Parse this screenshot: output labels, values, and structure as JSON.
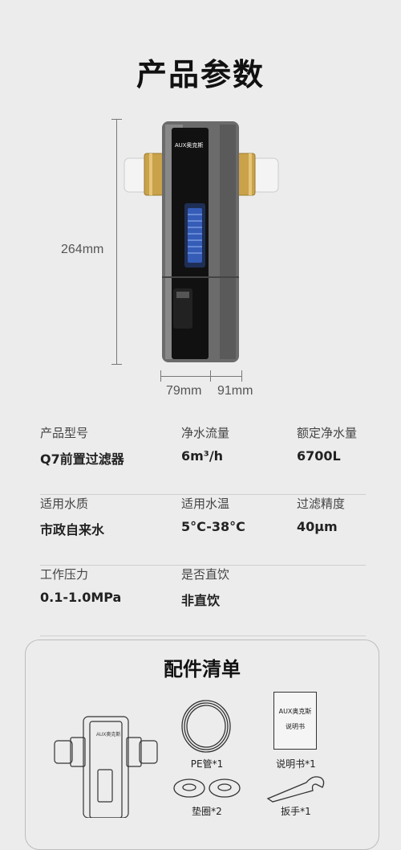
{
  "page_title": "产品参数",
  "dimensions": {
    "height": "264mm",
    "width": "79mm",
    "depth": "91mm"
  },
  "device_brand": "AUX奥克斯",
  "specs": [
    [
      {
        "label": "产品型号",
        "value": "Q7前置过滤器"
      },
      {
        "label": "净水流量",
        "value": "6m³/h"
      },
      {
        "label": "额定净水量",
        "value": "6700L"
      }
    ],
    [
      {
        "label": "适用水质",
        "value": "市政自来水"
      },
      {
        "label": "适用水温",
        "value": "5°C-38°C"
      },
      {
        "label": "过滤精度",
        "value": "40μm"
      }
    ],
    [
      {
        "label": "工作压力",
        "value": "0.1-1.0MPa"
      },
      {
        "label": "是否直饮",
        "value": "非直饮"
      }
    ]
  ],
  "accessories": {
    "title": "配件清单",
    "items": [
      {
        "label": "PE管*1"
      },
      {
        "label": "说明书*1"
      },
      {
        "label": "垫圈*2"
      },
      {
        "label": "扳手*1"
      }
    ],
    "manual_brand": "AUX奥克斯",
    "manual_text": "说明书",
    "line_brand": "AUX奥克斯"
  },
  "colors": {
    "background": "#ececec",
    "body": "#6b6b6b",
    "panel": "#111111",
    "brass": "#c9a24a",
    "pipe": "#f4f4f4",
    "filter": "#3a64c9"
  }
}
